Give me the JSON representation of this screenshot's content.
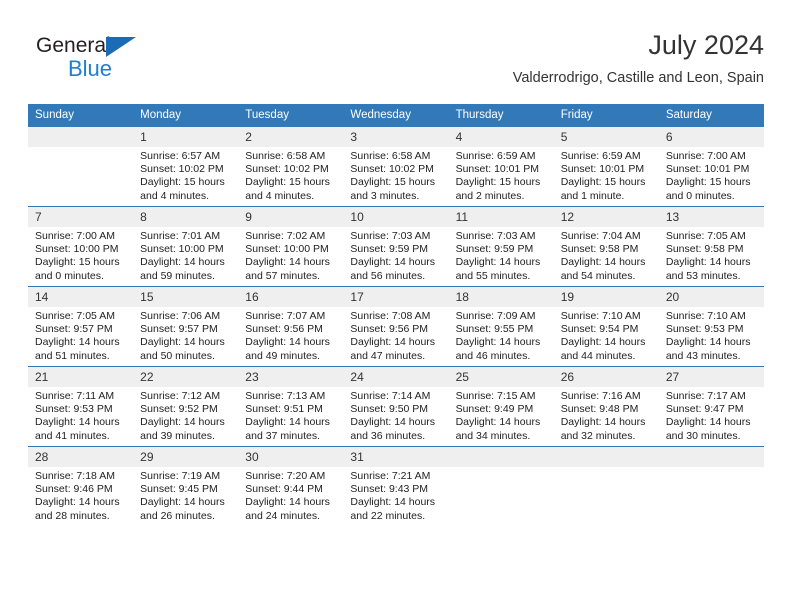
{
  "logo": {
    "name_part1": "General",
    "name_part2": "Blue",
    "accent_color": "#1c7fd4"
  },
  "header": {
    "month_title": "July 2024",
    "location": "Valderrodrigo, Castille and Leon, Spain"
  },
  "theme": {
    "header_bg": "#3179b8",
    "header_text": "#ffffff",
    "daynum_bg": "#efefef",
    "cell_bg": "#ffffff",
    "row_border": "#3179b8"
  },
  "weekdays": [
    "Sunday",
    "Monday",
    "Tuesday",
    "Wednesday",
    "Thursday",
    "Friday",
    "Saturday"
  ],
  "labels": {
    "sunrise_prefix": "Sunrise:",
    "sunset_prefix": "Sunset:",
    "daylight_prefix": "Daylight:"
  },
  "weeks": [
    [
      {
        "day": "",
        "l1": "",
        "l2": "",
        "l3": "",
        "l4": ""
      },
      {
        "day": "1",
        "l1": "Sunrise: 6:57 AM",
        "l2": "Sunset: 10:02 PM",
        "l3": "Daylight: 15 hours",
        "l4": "and 4 minutes."
      },
      {
        "day": "2",
        "l1": "Sunrise: 6:58 AM",
        "l2": "Sunset: 10:02 PM",
        "l3": "Daylight: 15 hours",
        "l4": "and 4 minutes."
      },
      {
        "day": "3",
        "l1": "Sunrise: 6:58 AM",
        "l2": "Sunset: 10:02 PM",
        "l3": "Daylight: 15 hours",
        "l4": "and 3 minutes."
      },
      {
        "day": "4",
        "l1": "Sunrise: 6:59 AM",
        "l2": "Sunset: 10:01 PM",
        "l3": "Daylight: 15 hours",
        "l4": "and 2 minutes."
      },
      {
        "day": "5",
        "l1": "Sunrise: 6:59 AM",
        "l2": "Sunset: 10:01 PM",
        "l3": "Daylight: 15 hours",
        "l4": "and 1 minute."
      },
      {
        "day": "6",
        "l1": "Sunrise: 7:00 AM",
        "l2": "Sunset: 10:01 PM",
        "l3": "Daylight: 15 hours",
        "l4": "and 0 minutes."
      }
    ],
    [
      {
        "day": "7",
        "l1": "Sunrise: 7:00 AM",
        "l2": "Sunset: 10:00 PM",
        "l3": "Daylight: 15 hours",
        "l4": "and 0 minutes."
      },
      {
        "day": "8",
        "l1": "Sunrise: 7:01 AM",
        "l2": "Sunset: 10:00 PM",
        "l3": "Daylight: 14 hours",
        "l4": "and 59 minutes."
      },
      {
        "day": "9",
        "l1": "Sunrise: 7:02 AM",
        "l2": "Sunset: 10:00 PM",
        "l3": "Daylight: 14 hours",
        "l4": "and 57 minutes."
      },
      {
        "day": "10",
        "l1": "Sunrise: 7:03 AM",
        "l2": "Sunset: 9:59 PM",
        "l3": "Daylight: 14 hours",
        "l4": "and 56 minutes."
      },
      {
        "day": "11",
        "l1": "Sunrise: 7:03 AM",
        "l2": "Sunset: 9:59 PM",
        "l3": "Daylight: 14 hours",
        "l4": "and 55 minutes."
      },
      {
        "day": "12",
        "l1": "Sunrise: 7:04 AM",
        "l2": "Sunset: 9:58 PM",
        "l3": "Daylight: 14 hours",
        "l4": "and 54 minutes."
      },
      {
        "day": "13",
        "l1": "Sunrise: 7:05 AM",
        "l2": "Sunset: 9:58 PM",
        "l3": "Daylight: 14 hours",
        "l4": "and 53 minutes."
      }
    ],
    [
      {
        "day": "14",
        "l1": "Sunrise: 7:05 AM",
        "l2": "Sunset: 9:57 PM",
        "l3": "Daylight: 14 hours",
        "l4": "and 51 minutes."
      },
      {
        "day": "15",
        "l1": "Sunrise: 7:06 AM",
        "l2": "Sunset: 9:57 PM",
        "l3": "Daylight: 14 hours",
        "l4": "and 50 minutes."
      },
      {
        "day": "16",
        "l1": "Sunrise: 7:07 AM",
        "l2": "Sunset: 9:56 PM",
        "l3": "Daylight: 14 hours",
        "l4": "and 49 minutes."
      },
      {
        "day": "17",
        "l1": "Sunrise: 7:08 AM",
        "l2": "Sunset: 9:56 PM",
        "l3": "Daylight: 14 hours",
        "l4": "and 47 minutes."
      },
      {
        "day": "18",
        "l1": "Sunrise: 7:09 AM",
        "l2": "Sunset: 9:55 PM",
        "l3": "Daylight: 14 hours",
        "l4": "and 46 minutes."
      },
      {
        "day": "19",
        "l1": "Sunrise: 7:10 AM",
        "l2": "Sunset: 9:54 PM",
        "l3": "Daylight: 14 hours",
        "l4": "and 44 minutes."
      },
      {
        "day": "20",
        "l1": "Sunrise: 7:10 AM",
        "l2": "Sunset: 9:53 PM",
        "l3": "Daylight: 14 hours",
        "l4": "and 43 minutes."
      }
    ],
    [
      {
        "day": "21",
        "l1": "Sunrise: 7:11 AM",
        "l2": "Sunset: 9:53 PM",
        "l3": "Daylight: 14 hours",
        "l4": "and 41 minutes."
      },
      {
        "day": "22",
        "l1": "Sunrise: 7:12 AM",
        "l2": "Sunset: 9:52 PM",
        "l3": "Daylight: 14 hours",
        "l4": "and 39 minutes."
      },
      {
        "day": "23",
        "l1": "Sunrise: 7:13 AM",
        "l2": "Sunset: 9:51 PM",
        "l3": "Daylight: 14 hours",
        "l4": "and 37 minutes."
      },
      {
        "day": "24",
        "l1": "Sunrise: 7:14 AM",
        "l2": "Sunset: 9:50 PM",
        "l3": "Daylight: 14 hours",
        "l4": "and 36 minutes."
      },
      {
        "day": "25",
        "l1": "Sunrise: 7:15 AM",
        "l2": "Sunset: 9:49 PM",
        "l3": "Daylight: 14 hours",
        "l4": "and 34 minutes."
      },
      {
        "day": "26",
        "l1": "Sunrise: 7:16 AM",
        "l2": "Sunset: 9:48 PM",
        "l3": "Daylight: 14 hours",
        "l4": "and 32 minutes."
      },
      {
        "day": "27",
        "l1": "Sunrise: 7:17 AM",
        "l2": "Sunset: 9:47 PM",
        "l3": "Daylight: 14 hours",
        "l4": "and 30 minutes."
      }
    ],
    [
      {
        "day": "28",
        "l1": "Sunrise: 7:18 AM",
        "l2": "Sunset: 9:46 PM",
        "l3": "Daylight: 14 hours",
        "l4": "and 28 minutes."
      },
      {
        "day": "29",
        "l1": "Sunrise: 7:19 AM",
        "l2": "Sunset: 9:45 PM",
        "l3": "Daylight: 14 hours",
        "l4": "and 26 minutes."
      },
      {
        "day": "30",
        "l1": "Sunrise: 7:20 AM",
        "l2": "Sunset: 9:44 PM",
        "l3": "Daylight: 14 hours",
        "l4": "and 24 minutes."
      },
      {
        "day": "31",
        "l1": "Sunrise: 7:21 AM",
        "l2": "Sunset: 9:43 PM",
        "l3": "Daylight: 14 hours",
        "l4": "and 22 minutes."
      },
      {
        "day": "",
        "l1": "",
        "l2": "",
        "l3": "",
        "l4": ""
      },
      {
        "day": "",
        "l1": "",
        "l2": "",
        "l3": "",
        "l4": ""
      },
      {
        "day": "",
        "l1": "",
        "l2": "",
        "l3": "",
        "l4": ""
      }
    ]
  ]
}
